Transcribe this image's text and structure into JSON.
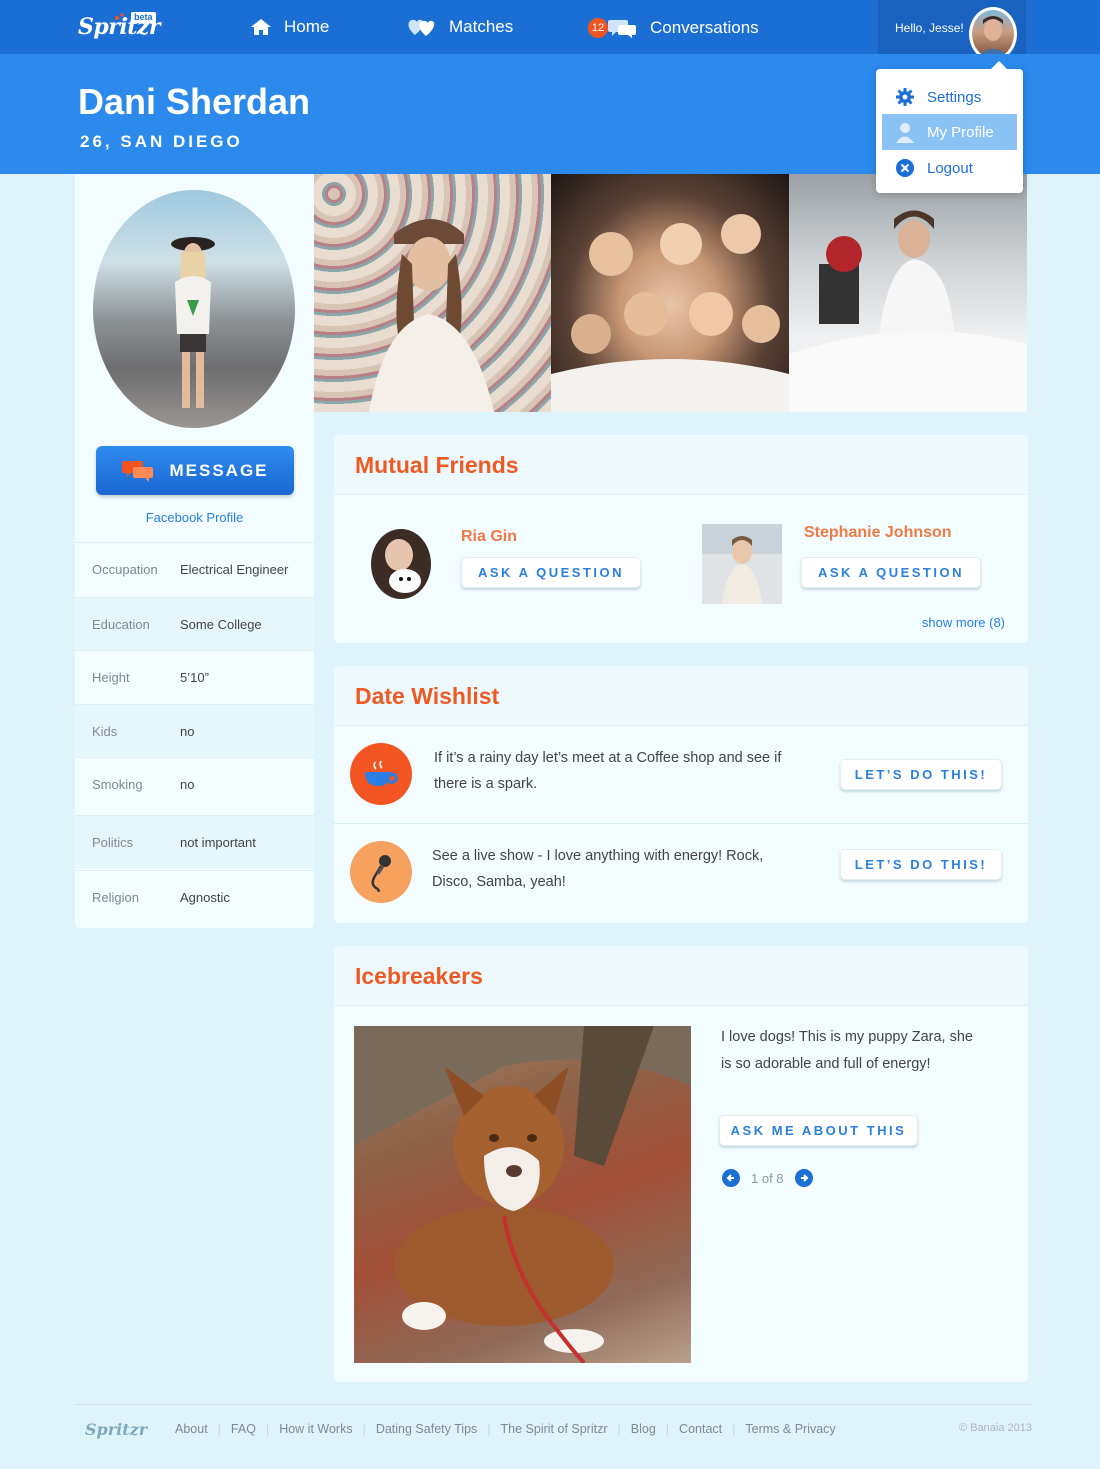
{
  "nav": {
    "logo": "Spritzr",
    "beta": "beta",
    "home": "Home",
    "matches": "Matches",
    "conversations": "Conversations",
    "conversations_badge": "12",
    "hello": "Hello, Jesse!"
  },
  "dropdown": {
    "items": [
      {
        "label": "Settings",
        "icon": "gear-icon"
      },
      {
        "label": "My Profile",
        "icon": "user-icon",
        "active": true
      },
      {
        "label": "Logout",
        "icon": "close-circle-icon"
      }
    ]
  },
  "profile": {
    "name": "Dani Sherdan",
    "subtitle": "26, SAN DIEGO",
    "message_button": "MESSAGE",
    "facebook_link": "Facebook Profile",
    "attributes": [
      {
        "label": "Occupation",
        "value": "Electrical Engineer"
      },
      {
        "label": "Education",
        "value": "Some College"
      },
      {
        "label": "Height",
        "value": "5’10”"
      },
      {
        "label": "Kids",
        "value": "no"
      },
      {
        "label": "Smoking",
        "value": "no"
      },
      {
        "label": "Politics",
        "value": "not important"
      },
      {
        "label": "Religion",
        "value": "Agnostic"
      }
    ]
  },
  "mutual_friends": {
    "title": "Mutual Friends",
    "friends": [
      {
        "name": "Ria Gin",
        "button": "ASK A QUESTION"
      },
      {
        "name": "Stephanie Johnson",
        "button": "ASK A QUESTION"
      }
    ],
    "show_more": "show more (8)"
  },
  "wishlist": {
    "title": "Date Wishlist",
    "items": [
      {
        "text": "If it’s a rainy day let’s meet at a Coffee shop and see if there is a spark.",
        "button": "LET’S DO THIS!",
        "icon": "coffee-cup-icon",
        "color": "#f25522"
      },
      {
        "text": "See a live show - I love anything with energy! Rock, Disco, Samba, yeah!",
        "button": "LET’S DO THIS!",
        "icon": "microphone-icon",
        "color": "#f7a15e"
      }
    ]
  },
  "icebreakers": {
    "title": "Icebreakers",
    "text": "I love dogs! This is my puppy Zara, she is so adorable and full of energy!",
    "button": "ASK ME ABOUT THIS",
    "pager": "1 of 8"
  },
  "footer": {
    "logo": "Spritzr",
    "links": [
      "About",
      "FAQ",
      "How it Works",
      "Dating Safety Tips",
      "The Spirit of Spritzr",
      "Blog",
      "Contact",
      "Terms & Privacy"
    ],
    "copyright": "© Banaia 2013"
  },
  "colors": {
    "nav": "#1b6fd4",
    "header": "#2b8aec",
    "accent": "#ee5a24",
    "link": "#2a80dc",
    "page_bg": "#def4fa"
  }
}
